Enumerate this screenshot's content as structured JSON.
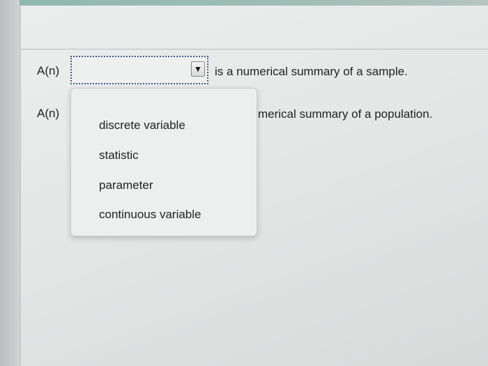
{
  "questions": [
    {
      "prefix": "A(n)",
      "selected_value": "",
      "suffix": "is a numerical summary of a sample."
    },
    {
      "prefix": "A(n)",
      "suffix_visible": "merical summary of a population."
    }
  ],
  "dropdown": {
    "arrow_glyph": "▼",
    "options": [
      "discrete variable",
      "statistic",
      "parameter",
      "continuous variable"
    ]
  }
}
